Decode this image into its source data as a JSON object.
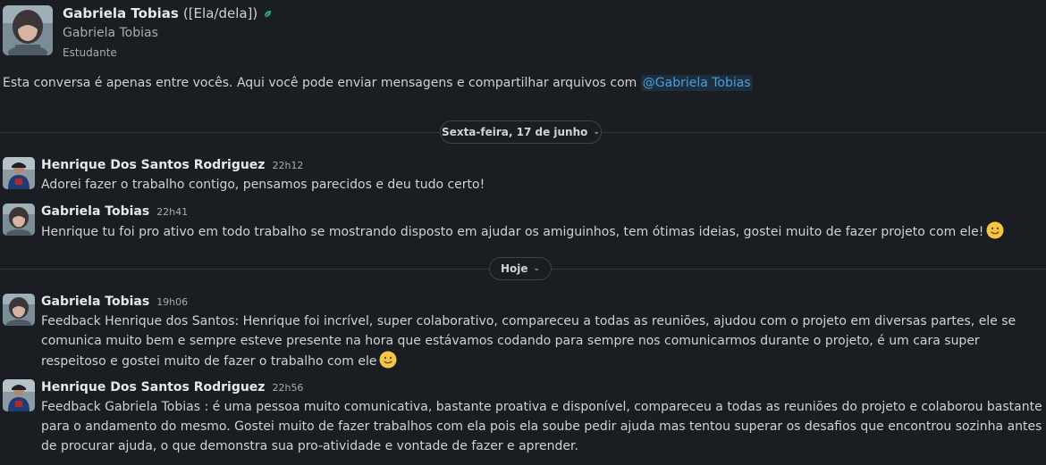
{
  "profile": {
    "name": "Gabriela Tobias",
    "pronouns": "([Ela/dela])",
    "display_name": "Gabriela Tobias",
    "title": "Estudante"
  },
  "intro": {
    "text": "Esta conversa é apenas entre vocês. Aqui você pode enviar mensagens e compartilhar arquivos com ",
    "mention": "@Gabriela Tobias"
  },
  "dates": {
    "first": "Sexta-feira, 17 de junho",
    "second": "Hoje"
  },
  "messages": [
    {
      "sender": "Henrique Dos Santos Rodriguez",
      "time": "22h12",
      "text": "Adorei fazer o trabalho contigo, pensamos parecidos e deu tudo certo!"
    },
    {
      "sender": "Gabriela Tobias",
      "time": "22h41",
      "text": "Henrique tu foi pro ativo em todo trabalho se mostrando disposto em ajudar os amiguinhos, tem ótimas ideias, gostei muito de fazer projeto com ele!"
    },
    {
      "sender": "Gabriela Tobias",
      "time": "19h06",
      "text": "Feedback Henrique dos Santos: Henrique foi incrível, super colaborativo, compareceu a todas as reuniões, ajudou com o projeto em diversas partes, ele se comunica muito bem e sempre esteve presente na hora que estávamos codando para sempre nos comunicarmos durante o projeto, é um cara super respeitoso e gostei muito de fazer o trabalho com ele"
    },
    {
      "sender": "Henrique Dos Santos Rodriguez",
      "time": "22h56",
      "text": "Feedback Gabriela Tobias : é uma pessoa muito comunicativa, bastante proativa e disponível, compareceu a todas as reuniões do projeto e colaborou bastante para o andamento do mesmo. Gostei muito de fazer trabalhos com ela pois ela soube pedir ajuda mas tentou superar os desafios que encontrou sozinha antes de procurar ajuda, o que demonstra sua pro-atividade e vontade de fazer e aprender."
    }
  ],
  "colors": {
    "background": "#1a1d21",
    "mention": "#4a9fd8",
    "leaf": "#2bac76"
  }
}
